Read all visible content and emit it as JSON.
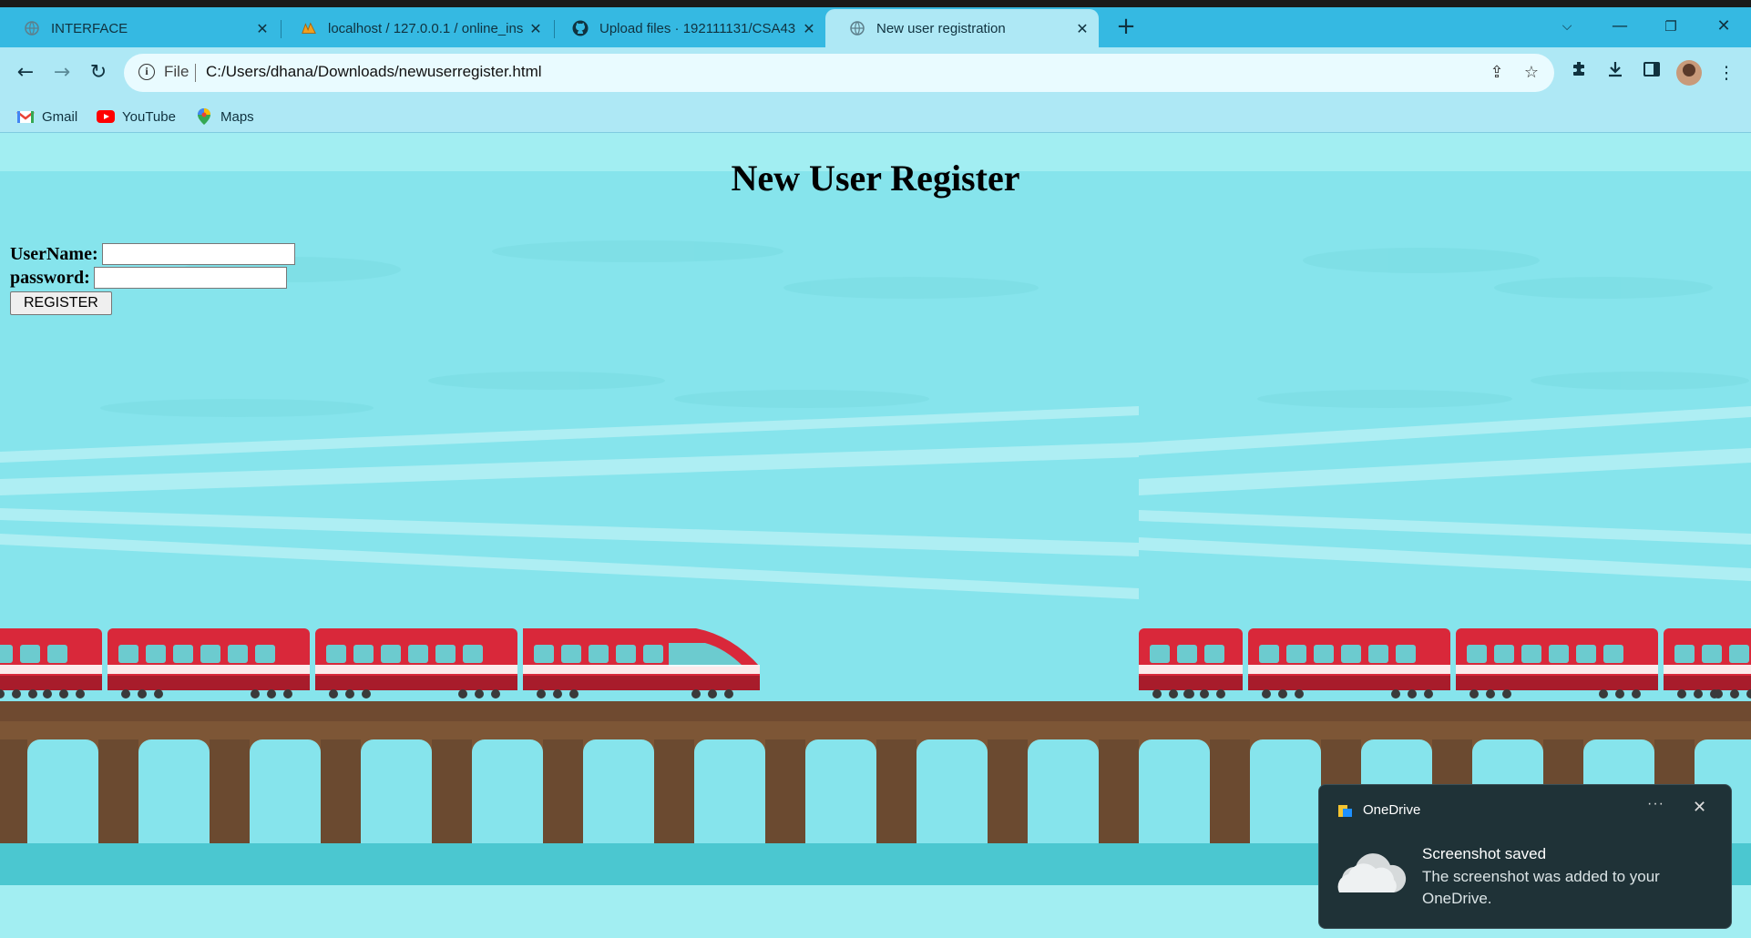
{
  "browser": {
    "tabs": [
      {
        "title": "INTERFACE",
        "active": false,
        "icon": "globe-icon"
      },
      {
        "title": "localhost / 127.0.0.1 / online_ins",
        "active": false,
        "icon": "phpmyadmin-icon"
      },
      {
        "title": "Upload files · 192111131/CSA43",
        "active": false,
        "icon": "github-icon"
      },
      {
        "title": "New user registration",
        "active": true,
        "icon": "globe-icon"
      }
    ],
    "address": {
      "scheme": "File",
      "url": "C:/Users/dhana/Downloads/newuserregister.html"
    },
    "bookmarks": [
      {
        "label": "Gmail",
        "icon": "gmail-icon"
      },
      {
        "label": "YouTube",
        "icon": "youtube-icon"
      },
      {
        "label": "Maps",
        "icon": "maps-icon"
      }
    ]
  },
  "page": {
    "heading": "New User Register",
    "form": {
      "username_label": "UserName:",
      "username_value": "",
      "password_label": "password:",
      "password_value": "",
      "submit_label": "REGISTER"
    }
  },
  "notification": {
    "app": "OneDrive",
    "title": "Screenshot saved",
    "message": "The screenshot was added to your OneDrive.",
    "more": "···"
  },
  "colors": {
    "tabstrip": "#35b9e2",
    "toolbar": "#aee8f5",
    "sky": "#86e4ec",
    "train_red": "#d9283a",
    "bridge_brown": "#7a5234",
    "toast_bg": "#1f3237"
  }
}
